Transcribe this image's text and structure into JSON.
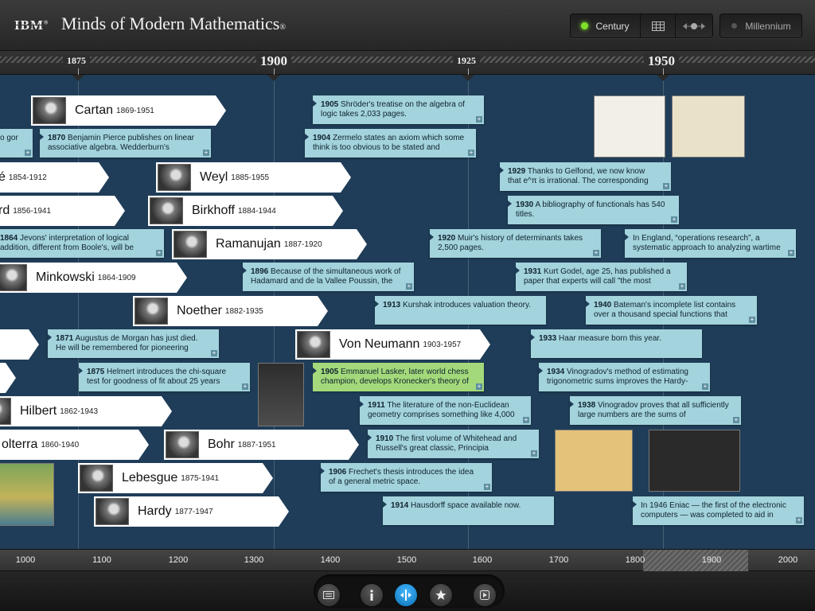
{
  "header": {
    "logo": "IBM",
    "logo_reg": "®",
    "title": "Minds of Modern Mathematics",
    "title_reg": "®",
    "century_label": "Century",
    "millennium_label": "Millennium"
  },
  "top_ruler": {
    "years": [
      {
        "label": "1875",
        "major": false
      },
      {
        "label": "1900",
        "major": true
      },
      {
        "label": "1925",
        "major": false
      },
      {
        "label": "1950",
        "major": true
      }
    ]
  },
  "people": [
    {
      "name": "Cartan",
      "dates": "1869-1951"
    },
    {
      "name": "",
      "dates": "1854-1912",
      "name_partial": "é"
    },
    {
      "name": "Weyl",
      "dates": "1885-1955"
    },
    {
      "name": "",
      "dates": "1856-1941",
      "name_partial": "rd"
    },
    {
      "name": "Birkhoff",
      "dates": "1884-1944"
    },
    {
      "name": "Ramanujan",
      "dates": "1887-1920"
    },
    {
      "name": "Minkowski",
      "dates": "1864-1909"
    },
    {
      "name": "Noether",
      "dates": "1882-1935"
    },
    {
      "name": "Von Neumann",
      "dates": "1903-1957"
    },
    {
      "name": "Hilbert",
      "dates": "1862-1943"
    },
    {
      "name": "Volterra",
      "dates": "1860-1940",
      "name_partial": "olterra"
    },
    {
      "name": "Bohr",
      "dates": "1887-1951"
    },
    {
      "name": "Lebesgue",
      "dates": "1875-1941"
    },
    {
      "name": "Hardy",
      "dates": "1877-1947"
    }
  ],
  "events": [
    {
      "year": "1905",
      "text": "Shröder's treatise on the algebra of logic takes 2,033 pages."
    },
    {
      "year": "",
      "text": "o gor"
    },
    {
      "year": "1870",
      "text": "Benjamin Pierce publishes on linear associative algebra. Wedderburn's"
    },
    {
      "year": "1904",
      "text": "Zermelo states an axiom which some think is too obvious to be stated and"
    },
    {
      "year": "1929",
      "text": "Thanks to Gelfond, we now know that e^π is irrational. The corresponding"
    },
    {
      "year": "1930",
      "text": "A bibliography of functionals has 540 titles."
    },
    {
      "year": "1864",
      "text": "Jevons' interpretation of logical addition, different from Boole's, will be"
    },
    {
      "year": "1920",
      "text": "Muir's history of determinants takes 2,500 pages."
    },
    {
      "year": "",
      "text": "In England, “operations research”, a systematic approach to analyzing wartime"
    },
    {
      "year": "1896",
      "text": "Because of the simultaneous work of Hadamard and de la Vallee Poussin, the"
    },
    {
      "year": "1931",
      "text": "Kurt Godel, age 25, has published a paper that experts will call \"the most"
    },
    {
      "year": "1913",
      "text": "Kurshak introduces valuation theory."
    },
    {
      "year": "1940",
      "text": "Bateman's incomplete list contains over a thousand special functions that"
    },
    {
      "year": "1871",
      "text": "Augustus de Morgan has just died. He will be remembered for pioneering"
    },
    {
      "year": "1933",
      "text": "Haar measure born this year."
    },
    {
      "year": "1875",
      "text": "Helmert introduces the chi-square test for goodness of fit about 25 years"
    },
    {
      "year": "1905",
      "text": "Emmanuel Lasker, later world chess champion, develops Kronecker's theory of"
    },
    {
      "year": "1934",
      "text": "Vinogradov's method of estimating trigonometric sums improves the Hardy-"
    },
    {
      "year": "1911",
      "text": "The literature of the non-Euclidean geometry comprises something like 4,000"
    },
    {
      "year": "1938",
      "text": "Vinogradov proves that all sufficiently large numbers are the sums of"
    },
    {
      "year": "1910",
      "text": "The first volume of Whitehead and Russell's great classic, Principia"
    },
    {
      "year": "1906",
      "text": "Frechet's thesis introduces the idea of a general metric space."
    },
    {
      "year": "1914",
      "text": "Hausdorff space available now."
    },
    {
      "year": "",
      "text": "In 1946 Eniac — the first of the electronic computers — was completed to aid in"
    }
  ],
  "bottom_ruler": {
    "labels": [
      "1000",
      "1100",
      "1200",
      "1300",
      "1400",
      "1500",
      "1600",
      "1700",
      "1800",
      "1900",
      "2000"
    ]
  },
  "toolbar": {
    "icons": [
      "list-icon",
      "info-icon",
      "timeline-icon",
      "star-icon",
      "play-icon"
    ],
    "active": "timeline-icon"
  }
}
